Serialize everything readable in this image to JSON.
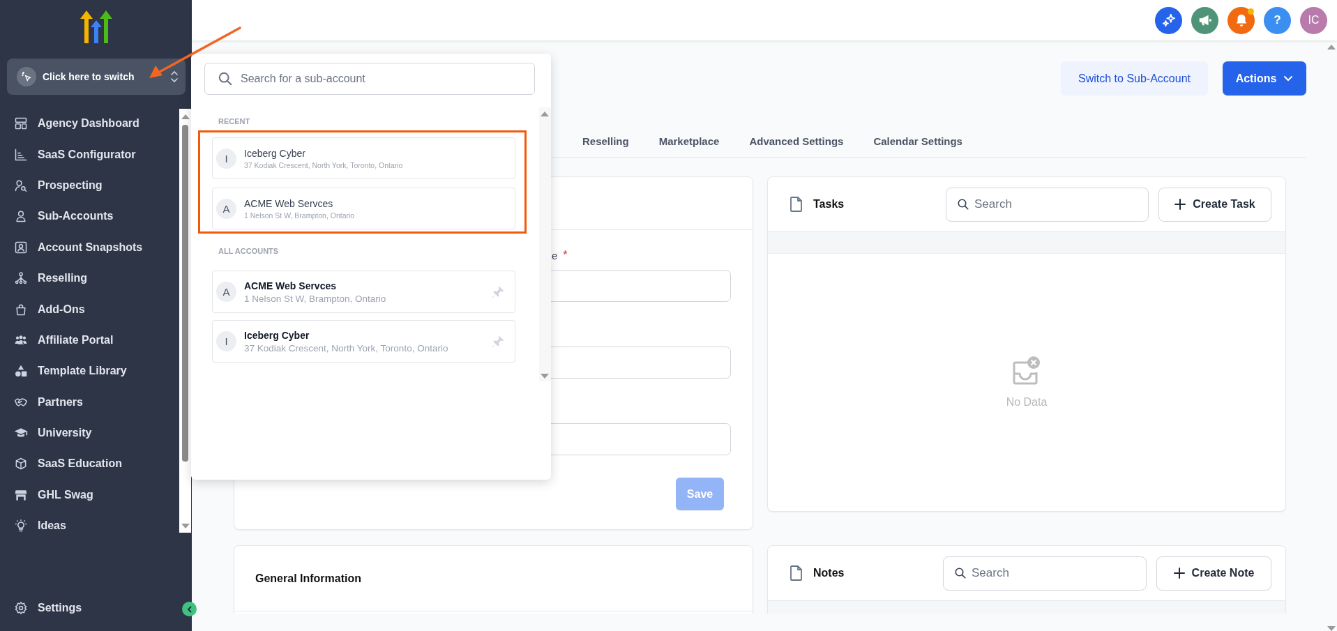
{
  "sidebar": {
    "switcher": {
      "label": "Click here to switch"
    },
    "items": [
      {
        "label": "Agency Dashboard"
      },
      {
        "label": "SaaS Configurator"
      },
      {
        "label": "Prospecting"
      },
      {
        "label": "Sub-Accounts"
      },
      {
        "label": "Account Snapshots"
      },
      {
        "label": "Reselling"
      },
      {
        "label": "Add-Ons"
      },
      {
        "label": "Affiliate Portal"
      },
      {
        "label": "Template Library"
      },
      {
        "label": "Partners"
      },
      {
        "label": "University"
      },
      {
        "label": "SaaS Education"
      },
      {
        "label": "GHL Swag"
      },
      {
        "label": "Ideas"
      }
    ],
    "footer_item": {
      "label": "Settings"
    }
  },
  "topbar": {
    "buttons": [
      {
        "kind": "sparkle",
        "color": "#2563eb"
      },
      {
        "kind": "megaphone",
        "color": "#4f9479"
      },
      {
        "kind": "bell",
        "color": "#f26a10",
        "has_notification": true
      },
      {
        "kind": "help",
        "color": "#3b8ff0",
        "label": "?"
      },
      {
        "kind": "avatar",
        "color": "#b87bab",
        "label": "IC"
      }
    ]
  },
  "header": {
    "buttons": [
      {
        "label": "Switch to Sub-Account",
        "kind": "secondary"
      },
      {
        "label": "Actions",
        "kind": "primary",
        "has_menu": true
      }
    ]
  },
  "tabs": [
    {
      "label": "Reselling",
      "selected": false
    },
    {
      "label": "Marketplace",
      "selected": false
    },
    {
      "label": "Advanced Settings",
      "selected": false
    },
    {
      "label": "Calendar Settings",
      "selected": false
    }
  ],
  "form_card": {
    "fields": [
      {
        "kind": "text",
        "label": "e",
        "marker": "*"
      },
      {
        "kind": "text"
      },
      {
        "kind": "text"
      }
    ],
    "save_button": {
      "label": "Save",
      "disabled": true
    }
  },
  "tasks_card": {
    "title": "Tasks",
    "search": {
      "placeholder": "Search"
    },
    "create_button": {
      "label": "Create Task"
    },
    "empty_text": "No Data"
  },
  "general_card": {
    "title": "General Information"
  },
  "notes_card": {
    "title": "Notes",
    "search": {
      "placeholder": "Search"
    },
    "create_button": {
      "label": "Create Note"
    }
  },
  "account_switcher": {
    "search": {
      "placeholder": "Search for a sub-account"
    },
    "sections": [
      {
        "title": "RECENT",
        "kind": "recent",
        "highlighted": true,
        "accounts": [
          {
            "initial": "I",
            "name": "Iceberg Cyber",
            "address": "37 Kodiak Crescent, North York, Toronto, Ontario"
          },
          {
            "initial": "A",
            "name": "ACME Web Servces",
            "address": "1 Nelson St W, Brampton, Ontario"
          }
        ]
      },
      {
        "title": "ALL ACCOUNTS",
        "kind": "all",
        "highlighted": false,
        "accounts": [
          {
            "initial": "A",
            "name": "ACME Web Servces",
            "address": "1 Nelson St W, Brampton, Ontario",
            "pinned": false
          },
          {
            "initial": "I",
            "name": "Iceberg Cyber",
            "address": "37 Kodiak Crescent, North York, Toronto, Ontario",
            "pinned": false
          }
        ]
      }
    ]
  },
  "annotation": {
    "arrow": true
  }
}
